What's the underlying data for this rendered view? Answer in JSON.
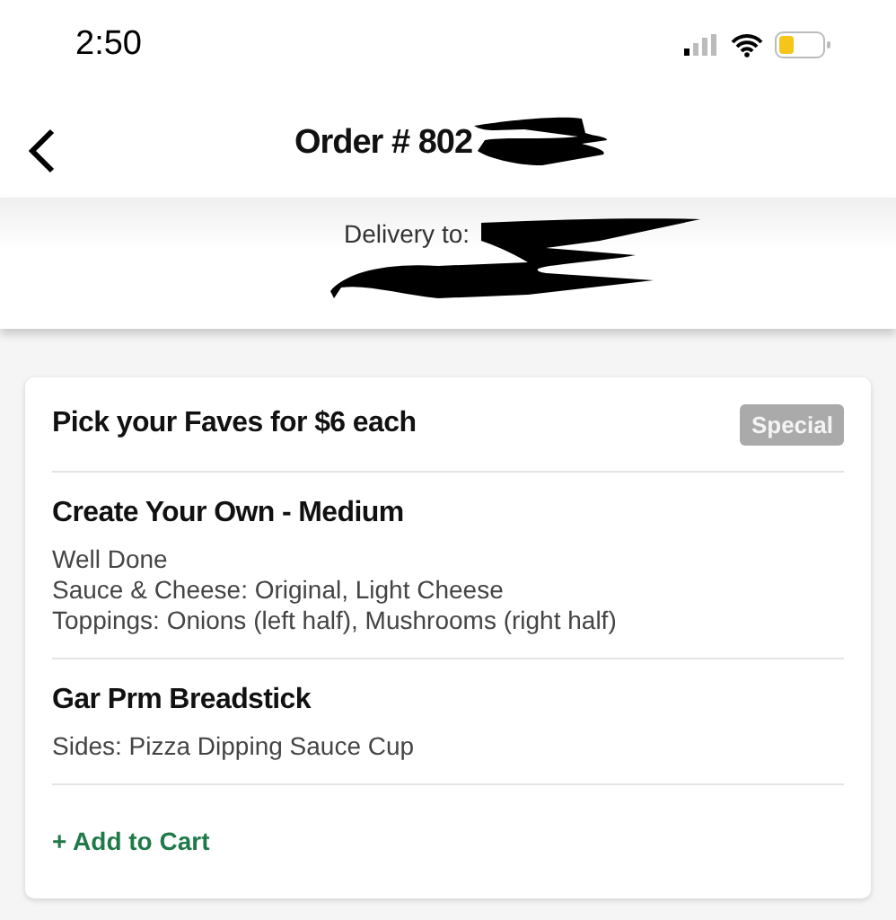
{
  "status_bar": {
    "time": "2:50"
  },
  "header": {
    "title": "Order # 802"
  },
  "delivery": {
    "label": "Delivery to:"
  },
  "deal": {
    "title": "Pick your Faves for $6 each",
    "badge": "Special",
    "items": [
      {
        "name": "Create Your Own - Medium",
        "details": [
          "Well Done",
          "Sauce & Cheese: Original, Light Cheese",
          "Toppings: Onions (left half), Mushrooms (right half)"
        ]
      },
      {
        "name": "Gar Prm Breadstick",
        "details": [
          "Sides: Pizza Dipping Sauce Cup"
        ]
      }
    ],
    "action": "+ Add to Cart"
  }
}
